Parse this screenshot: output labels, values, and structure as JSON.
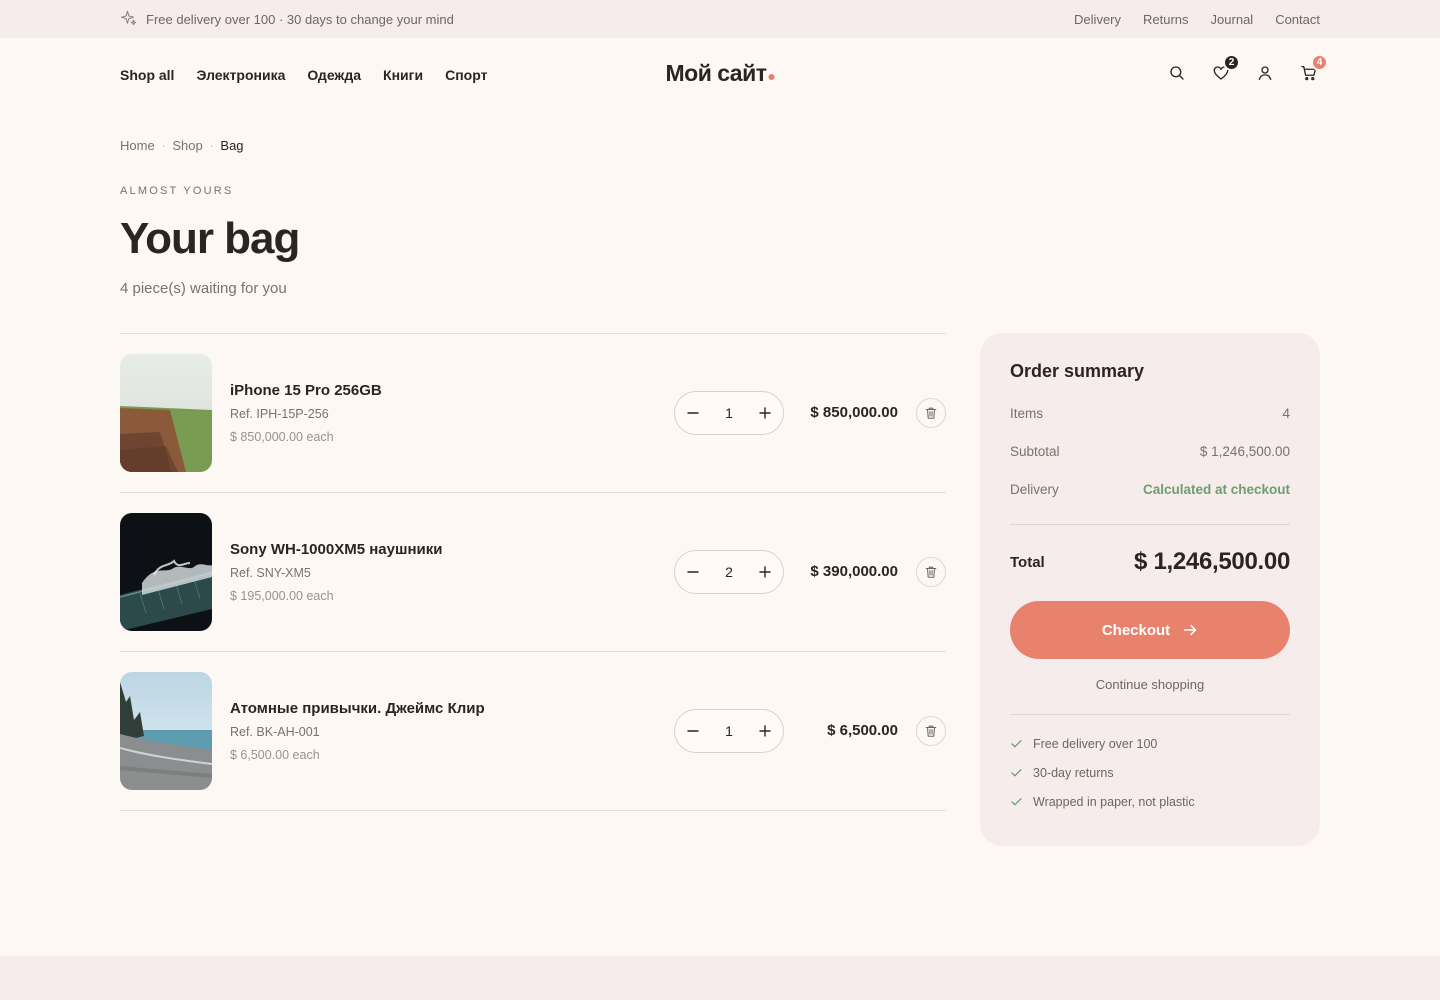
{
  "topbar": {
    "promo": "Free delivery over 100 · 30 days to change your mind",
    "links": [
      "Delivery",
      "Returns",
      "Journal",
      "Contact"
    ]
  },
  "header": {
    "nav": [
      "Shop all",
      "Электроника",
      "Одежда",
      "Книги",
      "Спорт"
    ],
    "logo": "Мой сайт",
    "wishlist_count": "2",
    "cart_count": "4",
    "icons": [
      "search-icon",
      "heart-icon",
      "user-icon",
      "cart-icon"
    ]
  },
  "breadcrumb": [
    "Home",
    "Shop",
    "Bag"
  ],
  "page": {
    "eyebrow": "ALMOST YOURS",
    "title": "Your bag",
    "subtitle": "4 piece(s) waiting for you"
  },
  "cart_items": [
    {
      "name": "iPhone 15 Pro 256GB",
      "ref": "Ref. IPH-15P-256",
      "each": "$ 850,000.00 each",
      "qty": "1",
      "total": "$ 850,000.00"
    },
    {
      "name": "Sony WH-1000XM5 наушники",
      "ref": "Ref. SNY-XM5",
      "each": "$ 195,000.00 each",
      "qty": "2",
      "total": "$ 390,000.00"
    },
    {
      "name": "Атомные привычки. Джеймс Клир",
      "ref": "Ref. BK-AH-001",
      "each": "$ 6,500.00 each",
      "qty": "1",
      "total": "$ 6,500.00"
    }
  ],
  "summary": {
    "title": "Order summary",
    "items_label": "Items",
    "items_value": "4",
    "subtotal_label": "Subtotal",
    "subtotal_value": "$ 1,246,500.00",
    "delivery_label": "Delivery",
    "delivery_value": "Calculated at checkout",
    "total_label": "Total",
    "total_value": "$ 1,246,500.00",
    "checkout_label": "Checkout",
    "continue_label": "Continue shopping",
    "perks": [
      "Free delivery over 100",
      "30-day returns",
      "Wrapped in paper, not plastic"
    ]
  },
  "colors": {
    "accent": "#e8826c",
    "background": "#fef8f5",
    "panel": "#f6eceb",
    "text": "#2a2522",
    "positive": "#6f9c72"
  }
}
